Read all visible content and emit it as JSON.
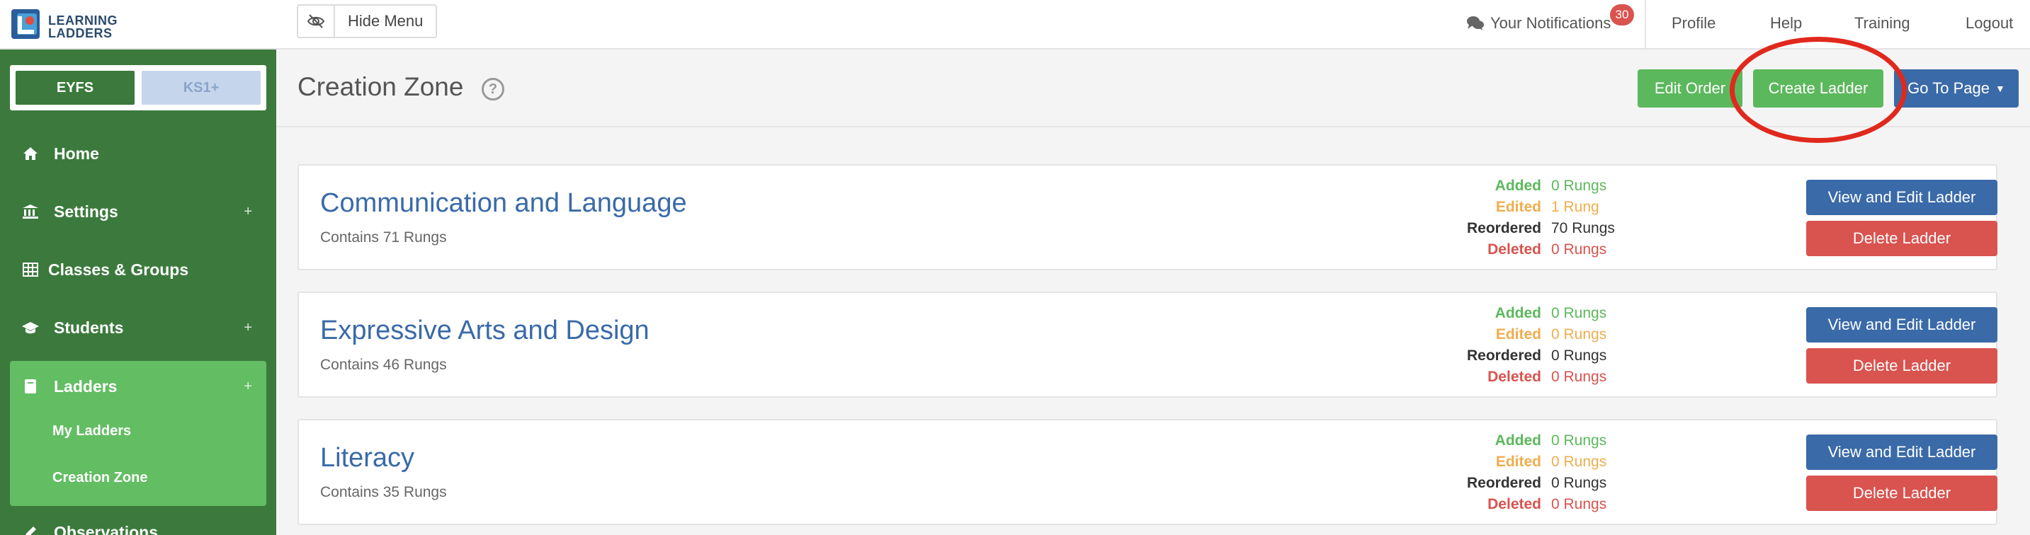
{
  "app": {
    "logo_text": [
      "LEARNING",
      "LADDERS"
    ]
  },
  "topbar": {
    "hide_menu_label": "Hide Menu",
    "notifications_label": "Your Notifications",
    "notifications_count": "30",
    "links": [
      "Profile",
      "Help",
      "Training",
      "Logout"
    ]
  },
  "sidebar": {
    "stages": [
      {
        "label": "EYFS",
        "active": true
      },
      {
        "label": "KS1+",
        "active": false
      }
    ],
    "items": [
      {
        "label": "Home",
        "icon": "home-icon",
        "expandable": false
      },
      {
        "label": "Settings",
        "icon": "bank-icon",
        "expandable": true
      },
      {
        "label": "Classes & Groups",
        "icon": "table-icon",
        "expandable": false
      },
      {
        "label": "Students",
        "icon": "graduation-cap-icon",
        "expandable": true
      },
      {
        "label": "Ladders",
        "icon": "book-icon",
        "expandable": true,
        "active": true
      }
    ],
    "sub_items": [
      "My Ladders",
      "Creation Zone"
    ],
    "partial_item": "Observations"
  },
  "header": {
    "title": "Creation Zone",
    "buttons": {
      "edit_order": "Edit Order",
      "create_ladder": "Create Ladder",
      "go_to_page": "Go To Page"
    }
  },
  "stat_labels": {
    "added": "Added",
    "edited": "Edited",
    "reordered": "Reordered",
    "deleted": "Deleted"
  },
  "ladders": [
    {
      "title": "Communication and Language",
      "subtitle": "Contains 71 Rungs",
      "added": "0 Rungs",
      "edited": "1 Rung",
      "reordered": "70 Rungs",
      "deleted": "0 Rungs",
      "view_label": "View and Edit Ladder",
      "delete_label": "Delete Ladder"
    },
    {
      "title": "Expressive Arts and Design",
      "subtitle": "Contains 46 Rungs",
      "added": "0 Rungs",
      "edited": "0 Rungs",
      "reordered": "0 Rungs",
      "deleted": "0 Rungs",
      "view_label": "View and Edit Ladder",
      "delete_label": "Delete Ladder"
    },
    {
      "title": "Literacy",
      "subtitle": "Contains 35 Rungs",
      "added": "0 Rungs",
      "edited": "0 Rungs",
      "reordered": "0 Rungs",
      "deleted": "0 Rungs",
      "view_label": "View and Edit Ladder",
      "delete_label": "Delete Ladder"
    }
  ],
  "colors": {
    "sidebar_green": "#3b7a3c",
    "sidebar_active": "#63bd63",
    "primary_blue": "#3a6aa8",
    "success_green": "#5cb85c",
    "danger_red": "#d9534f",
    "warning_orange": "#f0ad4e",
    "annotation_red": "#e0291d"
  }
}
